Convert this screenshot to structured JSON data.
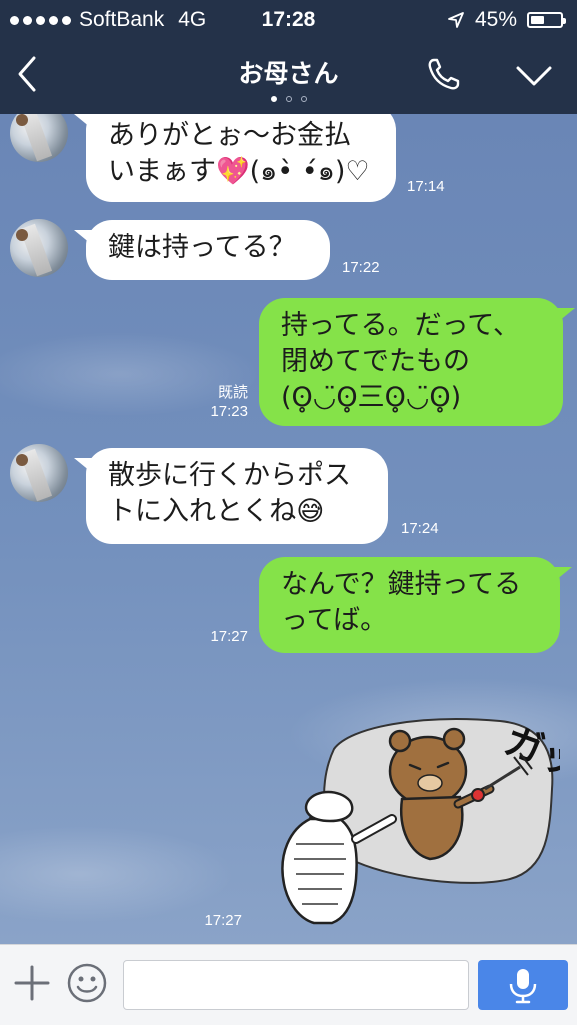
{
  "status_bar": {
    "carrier": "SoftBank",
    "network": "4G",
    "time": "17:28",
    "battery": "45%",
    "battery_level": 0.45
  },
  "header": {
    "title": "お母さん",
    "page_indicator_count": 3,
    "page_indicator_active": 0,
    "icons": [
      "back-chevron-icon",
      "phone-icon",
      "chevron-down-icon"
    ]
  },
  "messages": [
    {
      "direction": "in",
      "lines": [
        "ありがとぉ〜お金払",
        "いまぁす💖(๑•̀ •́๑)♡"
      ],
      "time": "17:14"
    },
    {
      "direction": "in",
      "lines": [
        "鍵は持ってる？"
      ],
      "time": "17:22"
    },
    {
      "direction": "out",
      "lines": [
        "持ってる。だって、",
        "閉めてでたもの",
        "(ʘ̥◡̈ʘ̥三ʘ̥◡̈ʘ̥)"
      ],
      "read": "既読",
      "time": "17:23"
    },
    {
      "direction": "in",
      "lines": [
        "散歩に行くからポス",
        "トに入れとくね😅"
      ],
      "time": "17:24"
    },
    {
      "direction": "out",
      "lines": [
        "なんで？鍵持ってる",
        "ってば。"
      ],
      "time": "17:27"
    },
    {
      "direction": "out",
      "type": "sticker",
      "sticker_text": "ガッ",
      "time": "17:27"
    }
  ],
  "input_bar": {
    "placeholder": "",
    "icons": [
      "plus-icon",
      "emoji-icon",
      "microphone-icon"
    ]
  },
  "colors": {
    "header_bg": "#243249",
    "incoming_bubble": "#ffffff",
    "outgoing_bubble": "#85e249",
    "send_button": "#4a86e8",
    "chat_bg": "#6f89b8"
  }
}
